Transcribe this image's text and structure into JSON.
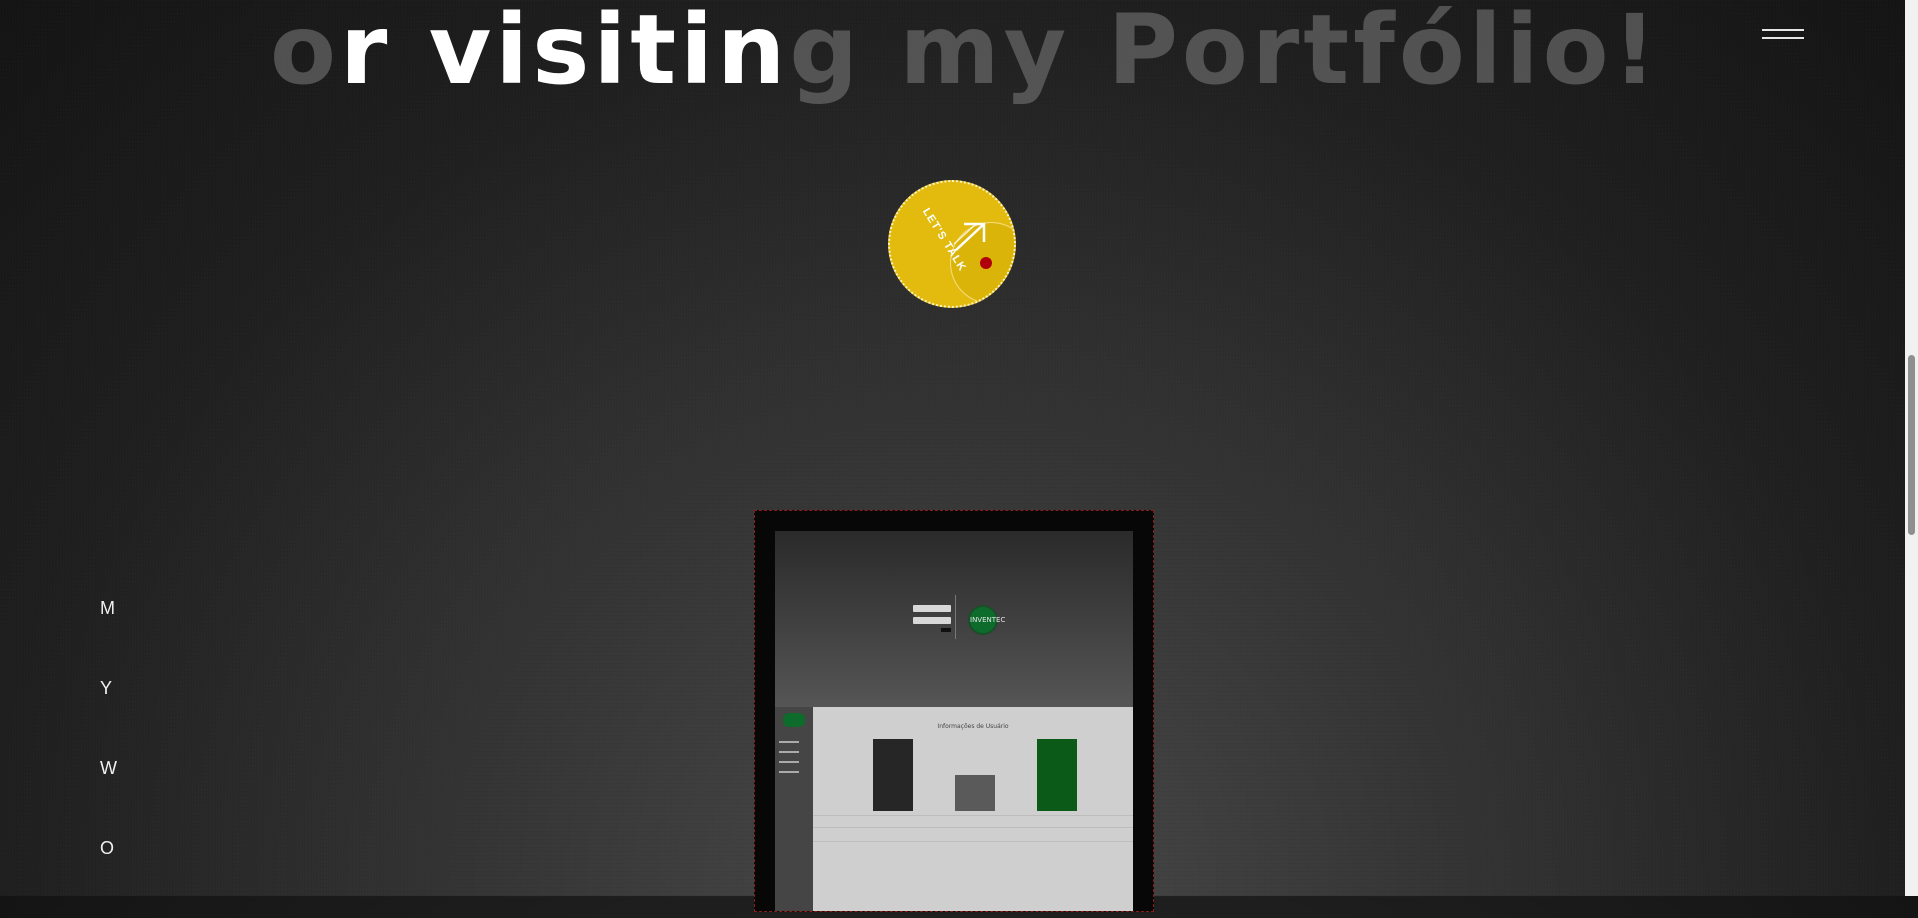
{
  "headline": {
    "part1": "o",
    "part2": "r visitin",
    "part3": "g my Portfólio!"
  },
  "menu": {
    "icon": "hamburger-menu-icon"
  },
  "cta": {
    "label": "LET'S TALK",
    "icon": "arrow-up-right-icon"
  },
  "side_letters": [
    "M",
    "Y",
    "W",
    "O"
  ],
  "project": {
    "login_logo": "INVENTEC",
    "dashboard_title": "Informações de Usuário",
    "bars": [
      {
        "value": 1.0,
        "color": "#262626"
      },
      {
        "value": 0.5,
        "color": "#5a5a5a"
      },
      {
        "value": 1.0,
        "color": "#0b5a18"
      }
    ]
  },
  "colors": {
    "accent": "#e2bb0e",
    "dot": "#b0000a",
    "brand_green": "#0d6b2b"
  }
}
